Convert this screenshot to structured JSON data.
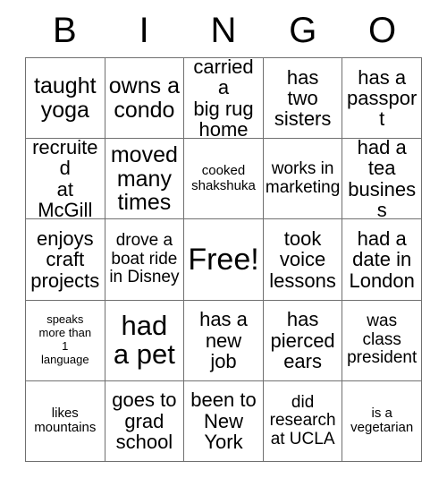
{
  "card": {
    "title": "Bingo Card",
    "header_letters": [
      "B",
      "I",
      "N",
      "G",
      "O"
    ],
    "rows": [
      [
        {
          "text": "taught\nyoga",
          "size": "lg"
        },
        {
          "text": "owns a\ncondo",
          "size": "lg"
        },
        {
          "text": "carried a\nbig rug\nhome",
          "size": "md"
        },
        {
          "text": "has\ntwo\nsisters",
          "size": "md"
        },
        {
          "text": "has a\npassport",
          "size": "md"
        }
      ],
      [
        {
          "text": "recruited\nat McGill",
          "size": "md"
        },
        {
          "text": "moved\nmany\ntimes",
          "size": "lg"
        },
        {
          "text": "cooked\nshakshuka",
          "size": "xs"
        },
        {
          "text": "works in\nmarketing",
          "size": "sm"
        },
        {
          "text": "had a\ntea\nbusiness",
          "size": "md"
        }
      ],
      [
        {
          "text": "enjoys\ncraft\nprojects",
          "size": "md"
        },
        {
          "text": "drove a\nboat ride\nin Disney",
          "size": "sm"
        },
        {
          "text": "Free!",
          "size": "free"
        },
        {
          "text": "took\nvoice\nlessons",
          "size": "md"
        },
        {
          "text": "had a\ndate in\nLondon",
          "size": "md"
        }
      ],
      [
        {
          "text": "speaks\nmore than\n1\nlanguage",
          "size": "xxs"
        },
        {
          "text": "had\na pet",
          "size": "xl"
        },
        {
          "text": "has a\nnew\njob",
          "size": "md"
        },
        {
          "text": "has\npierced\nears",
          "size": "md"
        },
        {
          "text": "was\nclass\npresident",
          "size": "sm"
        }
      ],
      [
        {
          "text": "likes\nmountains",
          "size": "xs"
        },
        {
          "text": "goes to\ngrad\nschool",
          "size": "md"
        },
        {
          "text": "been to\nNew\nYork",
          "size": "md"
        },
        {
          "text": "did\nresearch\nat UCLA",
          "size": "sm"
        },
        {
          "text": "is a\nvegetarian",
          "size": "xs"
        }
      ]
    ],
    "colors": {
      "background": "#ffffff",
      "text": "#000000",
      "grid_line": "#707070"
    }
  }
}
